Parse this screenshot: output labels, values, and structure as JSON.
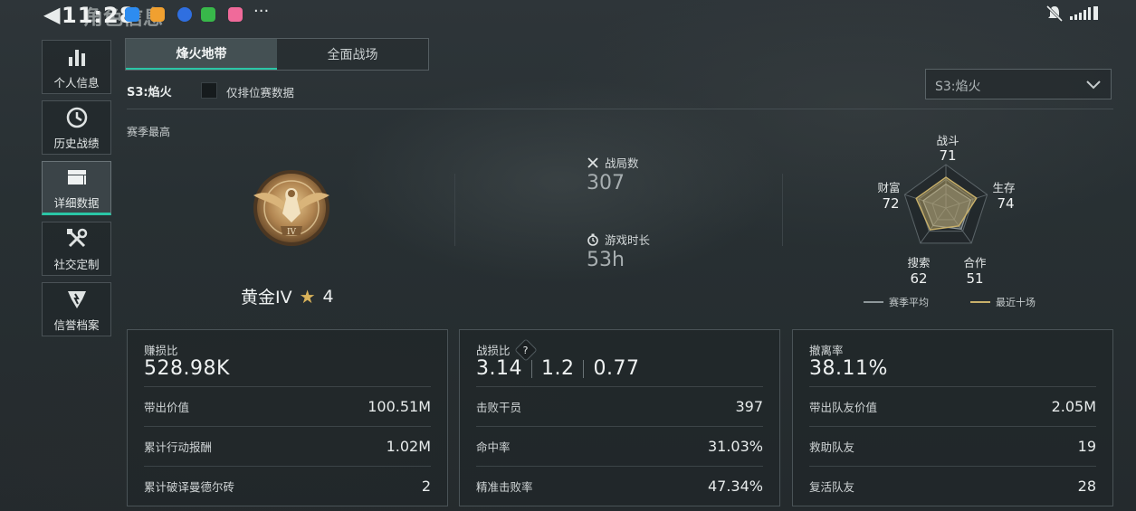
{
  "status_bar": {
    "clock": "11:28",
    "ghost_title": "角色信息",
    "more": "···"
  },
  "sidebar": {
    "items": [
      {
        "label": "个人信息",
        "icon": "bar-chart-icon"
      },
      {
        "label": "历史战绩",
        "icon": "history-clock-icon"
      },
      {
        "label": "详细数据",
        "icon": "folder-icon"
      },
      {
        "label": "社交定制",
        "icon": "tools-icon"
      },
      {
        "label": "信誉档案",
        "icon": "shield-badge-icon"
      }
    ],
    "active_index": 2
  },
  "tabs": [
    {
      "label": "烽火地带",
      "active": true
    },
    {
      "label": "全面战场",
      "active": false
    }
  ],
  "season": {
    "label": "S3:焰火",
    "ranked_only_label": "仅排位赛数据",
    "ranked_only_checked": false,
    "dropdown_value": "S3:焰火"
  },
  "season_best": {
    "label": "赛季最高",
    "rank_name": "黄金IV",
    "stars": "4",
    "medal_numeral": "IV"
  },
  "overview": {
    "matches_label": "战局数",
    "matches_value": "307",
    "playtime_label": "游戏时长",
    "playtime_value": "53h"
  },
  "radar": {
    "axes": [
      {
        "label": "战斗",
        "value": "71"
      },
      {
        "label": "生存",
        "value": "74"
      },
      {
        "label": "合作",
        "value": "51"
      },
      {
        "label": "搜索",
        "value": "62"
      },
      {
        "label": "财富",
        "value": "72"
      }
    ],
    "season_avg_fractions": [
      0.55,
      0.6,
      0.6,
      0.5,
      0.55
    ],
    "recent_fractions": [
      0.71,
      0.74,
      0.51,
      0.62,
      0.72
    ],
    "legend_season_avg": "赛季平均",
    "legend_recent": "最近十场",
    "color_season_avg": "#8e979a",
    "color_recent": "#c8b06a"
  },
  "cards": [
    {
      "title": "赚损比",
      "big": "528.98K",
      "rows": [
        {
          "k": "带出价值",
          "v": "100.51M"
        },
        {
          "k": "累计行动报酬",
          "v": "1.02M"
        },
        {
          "k": "累计破译曼德尔砖",
          "v": "2"
        }
      ]
    },
    {
      "title": "战损比",
      "big_parts": [
        "3.14",
        "1.2",
        "0.77"
      ],
      "help": "?",
      "rows": [
        {
          "k": "击败干员",
          "v": "397"
        },
        {
          "k": "命中率",
          "v": "31.03%"
        },
        {
          "k": "精准击败率",
          "v": "47.34%"
        }
      ]
    },
    {
      "title": "撤离率",
      "big": "38.11%",
      "rows": [
        {
          "k": "带出队友价值",
          "v": "2.05M"
        },
        {
          "k": "救助队友",
          "v": "19"
        },
        {
          "k": "复活队友",
          "v": "28"
        }
      ]
    }
  ],
  "colors": {
    "accent": "#2ac6a6",
    "gold": "#c8b06a"
  }
}
